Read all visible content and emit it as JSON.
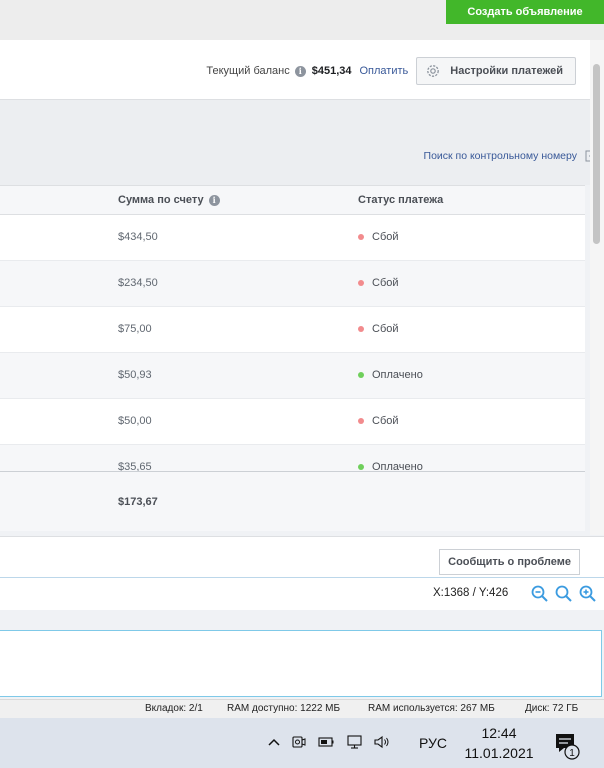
{
  "header": {
    "create_ad_label": "Создать объявление"
  },
  "balance": {
    "label": "Текущий баланс",
    "amount": "$451,34",
    "pay_link": "Оплатить",
    "settings_label": "Настройки платежей"
  },
  "search_link": "Поиск по контрольному номеру",
  "table": {
    "columns": [
      "Сумма по счету",
      "Статус платежа"
    ],
    "rows": [
      {
        "amount": "$434,50",
        "status": "Сбой",
        "status_color": "#f28b8d"
      },
      {
        "amount": "$234,50",
        "status": "Сбой",
        "status_color": "#f28b8d"
      },
      {
        "amount": "$75,00",
        "status": "Сбой",
        "status_color": "#f28b8d"
      },
      {
        "amount": "$50,93",
        "status": "Оплачено",
        "status_color": "#6fcf5b"
      },
      {
        "amount": "$50,00",
        "status": "Сбой",
        "status_color": "#f28b8d"
      },
      {
        "amount": "$35,65",
        "status": "Оплачено",
        "status_color": "#6fcf5b"
      }
    ],
    "total": "$173,67"
  },
  "report_button": "Сообщить о проблеме",
  "coordinates": "X:1368 / Y:426",
  "status_bar": {
    "tabs": "Вкладок: 2/1",
    "ram_available": "RAM доступно: 1222 МБ",
    "ram_used": "RAM используется: 267 МБ",
    "disk": "Диск: 72 ГБ"
  },
  "taskbar": {
    "language": "РУС",
    "time": "12:44",
    "date": "11.01.2021",
    "notification_count": "1"
  }
}
